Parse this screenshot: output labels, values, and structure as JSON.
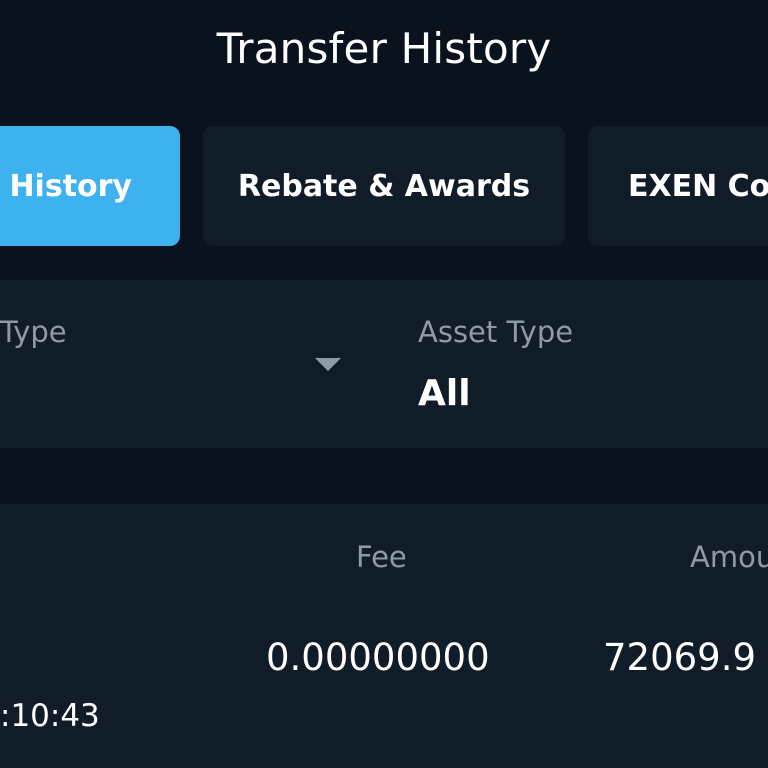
{
  "header": {
    "title": "Transfer History"
  },
  "tabs": [
    {
      "label": "r History",
      "active": true
    },
    {
      "label": "Rebate & Awards",
      "active": false
    },
    {
      "label": "EXEN Co",
      "active": false
    }
  ],
  "filters": {
    "type_label": "Type",
    "asset_type_label": "Asset Type",
    "asset_type_value": "All"
  },
  "record": {
    "fee_header": "Fee",
    "amount_header": "Amou",
    "fee_value": "0.00000000",
    "amount_value": "72069.9",
    "time_value": ":10:43"
  },
  "colors": {
    "background": "#0a131d",
    "panel": "#111c29",
    "accent": "#3eb1ef",
    "muted_text": "#8f9aa8"
  }
}
